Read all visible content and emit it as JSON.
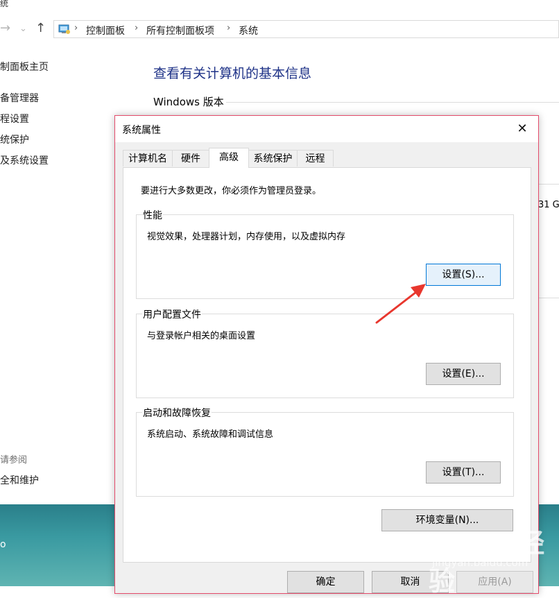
{
  "control_panel": {
    "title_fragment": "统",
    "breadcrumb": [
      "控制面板",
      "所有控制面板项",
      "系统"
    ],
    "sidebar": {
      "home": "制面板主页",
      "links": [
        "备管理器",
        "程设置",
        "统保护",
        "及系统设置"
      ],
      "see_also": "请参阅",
      "see_also_link": "全和维护"
    },
    "heading": "查看有关计算机的基本信息",
    "section": "Windows 版本",
    "fragment_right": "31 G"
  },
  "desktop": {
    "fragment": "o"
  },
  "dialog": {
    "title": "系统属性",
    "tabs": [
      "计算机名",
      "硬件",
      "高级",
      "系统保护",
      "远程"
    ],
    "active_tab": "高级",
    "notice": "要进行大多数更改，你必须作为管理员登录。",
    "groups": [
      {
        "label": "性能",
        "desc": "视觉效果，处理器计划，内存使用，以及虚拟内存",
        "button": "设置(S)..."
      },
      {
        "label": "用户配置文件",
        "desc": "与登录帐户相关的桌面设置",
        "button": "设置(E)..."
      },
      {
        "label": "启动和故障恢复",
        "desc": "系统启动、系统故障和调试信息",
        "button": "设置(T)..."
      }
    ],
    "env_button": "环境变量(N)...",
    "footer_buttons": {
      "ok": "确定",
      "cancel": "取消",
      "apply": "应用(A)"
    }
  },
  "watermark": {
    "brand": "Baidu 经验",
    "url": "jingyan.baidu.com"
  },
  "colors": {
    "accent_blue": "#0078d7",
    "heading_blue": "#1e3287",
    "annotation_red": "#e8372e"
  }
}
